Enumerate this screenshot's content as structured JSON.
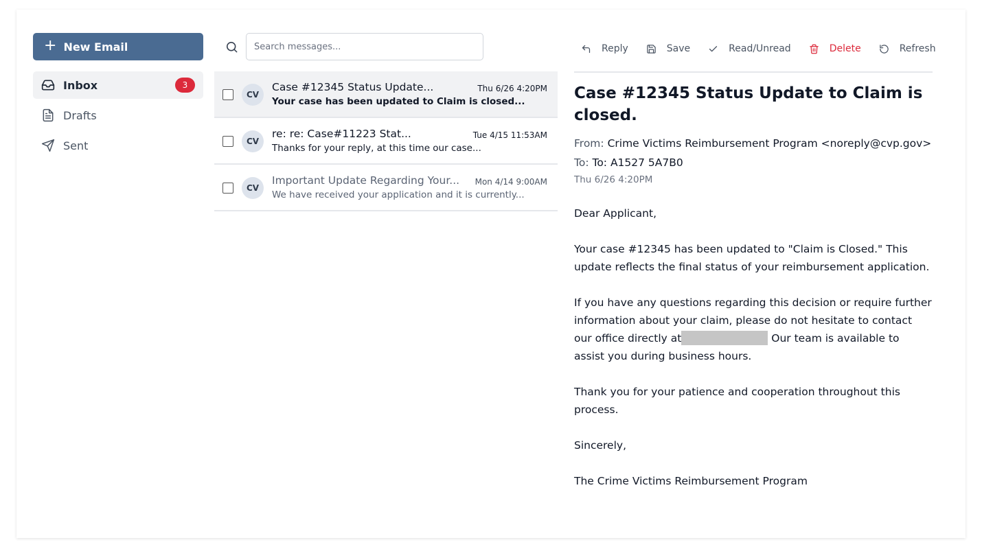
{
  "sidebar": {
    "new_email_label": "New Email",
    "items": [
      {
        "label": "Inbox",
        "badge": "3",
        "icon": "inbox-icon"
      },
      {
        "label": "Drafts",
        "icon": "file-text-icon"
      },
      {
        "label": "Sent",
        "icon": "send-icon"
      }
    ]
  },
  "search": {
    "placeholder": "Search messages..."
  },
  "messages": [
    {
      "initials": "CV",
      "subject": "Case #12345 Status Update...",
      "date": "Thu 6/26 4:20PM",
      "preview": "Your case has been updated to Claim is closed...",
      "selected": true,
      "unread": true
    },
    {
      "initials": "CV",
      "subject": "re: re: Case#11223 Stat...",
      "date": "Tue 4/15 11:53AM",
      "preview": "Thanks for your reply, at this time our case..."
    },
    {
      "initials": "CV",
      "subject": "Important Update Regarding Your...",
      "date": "Mon 4/14 9:00AM",
      "preview": "We have received your application and it is currently..."
    }
  ],
  "toolbar": {
    "reply": "Reply",
    "save": "Save",
    "read_unread": "Read/Unread",
    "delete": "Delete",
    "refresh": "Refresh"
  },
  "email": {
    "subject": "Case #12345 Status Update to Claim is closed.",
    "from_label": "From:",
    "from": "Crime Victims Reimbursement Program <noreply@cvp.gov>",
    "to_label": "To:",
    "to": "To: A1527 5A7B0",
    "date": "Thu 6/26 4:20PM",
    "greeting": "Dear Applicant,",
    "paragraph1": "Your case #12345 has been updated to \"Claim is Closed.\" This update reflects the final status of your reimbursement application.",
    "paragraph2_before": "If you have any questions regarding this decision or require further information about your claim, please do not hesitate to contact our office directly at",
    "paragraph2_after": " Our team is available to assist you during business hours.",
    "paragraph3": "Thank you for your patience and cooperation throughout this process.",
    "closing": "Sincerely,",
    "signature": "The Crime Victims Reimbursement Program"
  },
  "colors": {
    "primary": "#4a6b92",
    "badge": "#dc2a3b",
    "danger": "#dc2a3b",
    "selected_bg": "#f1f2f4"
  }
}
